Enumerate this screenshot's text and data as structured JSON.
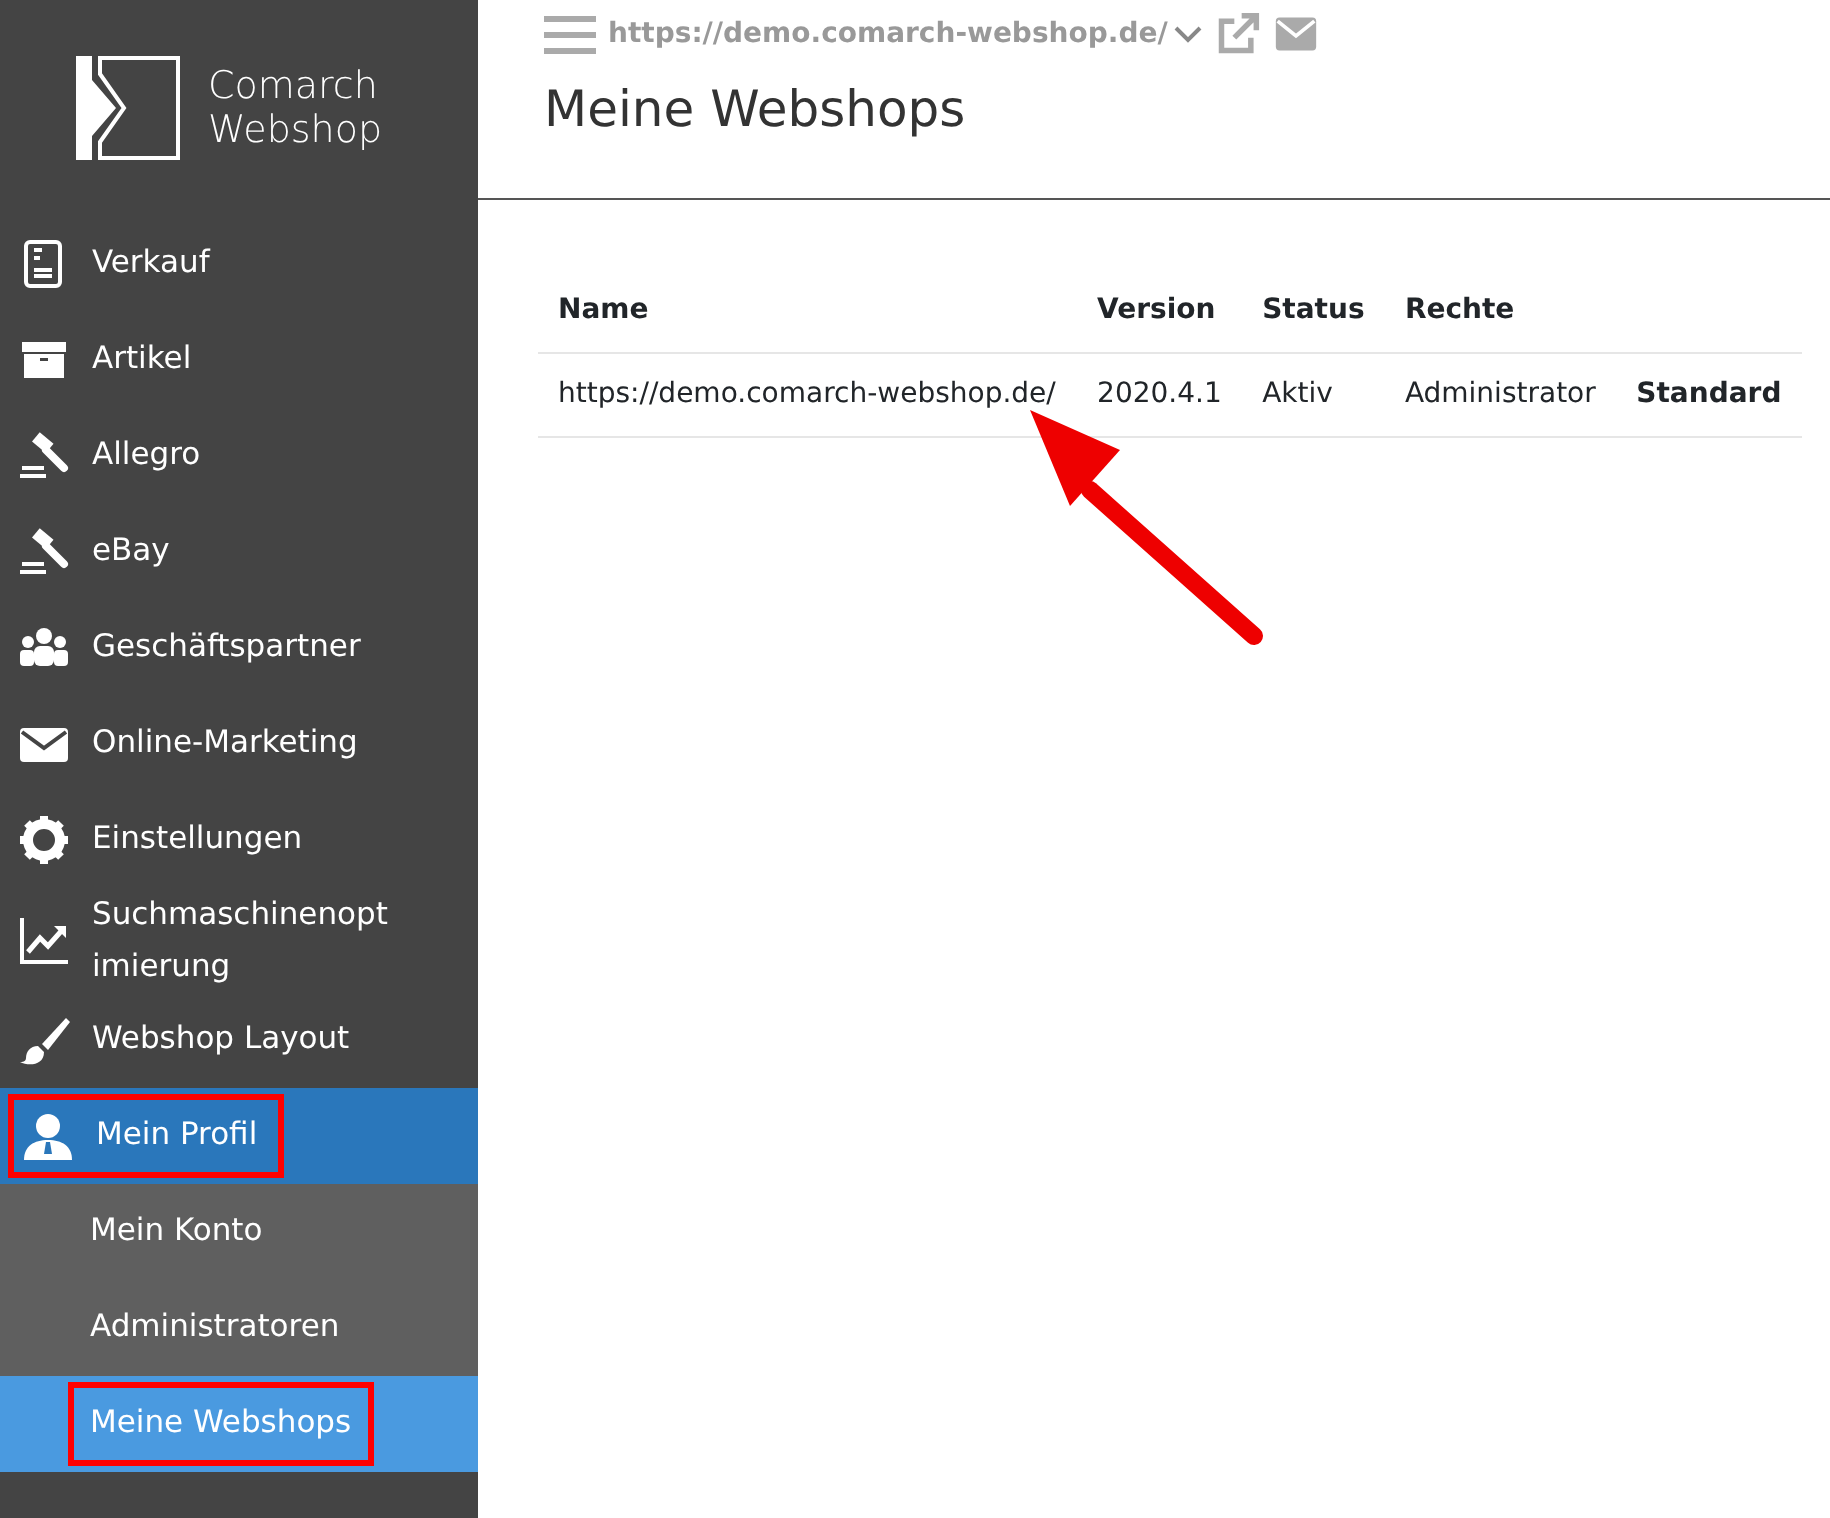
{
  "logo": {
    "line1": "Comarch",
    "line2": "Webshop"
  },
  "sidebar": {
    "items": [
      {
        "label": "Verkauf",
        "selected": false,
        "highlighted": false
      },
      {
        "label": "Artikel",
        "selected": false,
        "highlighted": false
      },
      {
        "label": "Allegro",
        "selected": false,
        "highlighted": false
      },
      {
        "label": "eBay",
        "selected": false,
        "highlighted": false
      },
      {
        "label": "Geschäftspartner",
        "selected": false,
        "highlighted": false
      },
      {
        "label": "Online-Marketing",
        "selected": false,
        "highlighted": false
      },
      {
        "label": "Einstellungen",
        "selected": false,
        "highlighted": false
      },
      {
        "label": "Suchmaschinenopt imierung",
        "selected": false,
        "highlighted": false
      },
      {
        "label": "Webshop Layout",
        "selected": false,
        "highlighted": false
      },
      {
        "label": "Mein Profil",
        "selected": true,
        "highlighted": true,
        "expanded": true,
        "children": [
          {
            "label": "Mein Konto",
            "selected": false,
            "highlighted": false
          },
          {
            "label": "Administratoren",
            "selected": false,
            "highlighted": false
          },
          {
            "label": "Meine Webshops",
            "selected": true,
            "highlighted": true
          }
        ]
      }
    ]
  },
  "topbar": {
    "shop_url": "https://demo.comarch-webshop.de/"
  },
  "page_title": "Meine Webshops",
  "table": {
    "columns": [
      "Name",
      "Version",
      "Status",
      "Rechte",
      ""
    ],
    "rows": [
      {
        "cells": [
          "https://demo.comarch-webshop.de/",
          "2020.4.1",
          "Aktiv",
          "Administrator",
          "Standard"
        ]
      }
    ]
  },
  "annotation": {
    "arrow": true
  }
}
